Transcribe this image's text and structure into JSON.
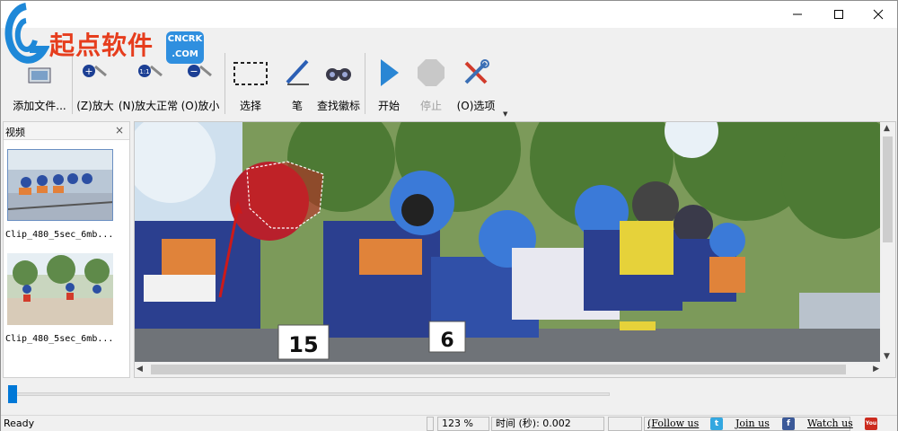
{
  "brand": {
    "logo_text": "起点软件",
    "badge_line1": "CNCRK",
    "badge_line2": ".COM"
  },
  "window": {
    "minimize_icon": "minimize-icon",
    "maximize_icon": "maximize-icon",
    "close_icon": "close-icon"
  },
  "toolbar": {
    "add_file": "添加文件...",
    "zoom_in": "(Z)放大",
    "zoom_normal": "(N)放大正常",
    "zoom_out": "(O)放小",
    "select": "选择",
    "pen": "笔",
    "find_logo": "查找徽标",
    "start": "开始",
    "stop": "停止",
    "options": "(O)选项"
  },
  "sidebar": {
    "title": "视频",
    "close": "×",
    "items": [
      {
        "caption": "Clip_480_5sec_6mb..."
      },
      {
        "caption": "Clip_480_5sec_6mb..."
      }
    ]
  },
  "viewer": {
    "bib_numbers": [
      "15",
      "6"
    ]
  },
  "timeline": {
    "position": 0.0
  },
  "status": {
    "state": "Ready",
    "zoom": "123 %",
    "time": "时间 (秒): 0.002",
    "follow": "(Follow us",
    "join": "Join us",
    "watch": "Watch us"
  },
  "colors": {
    "accent": "#0078d7",
    "logo_red": "#e63d1d",
    "badge_blue": "#2f8fdf",
    "marker_red": "#cc1a1a"
  }
}
